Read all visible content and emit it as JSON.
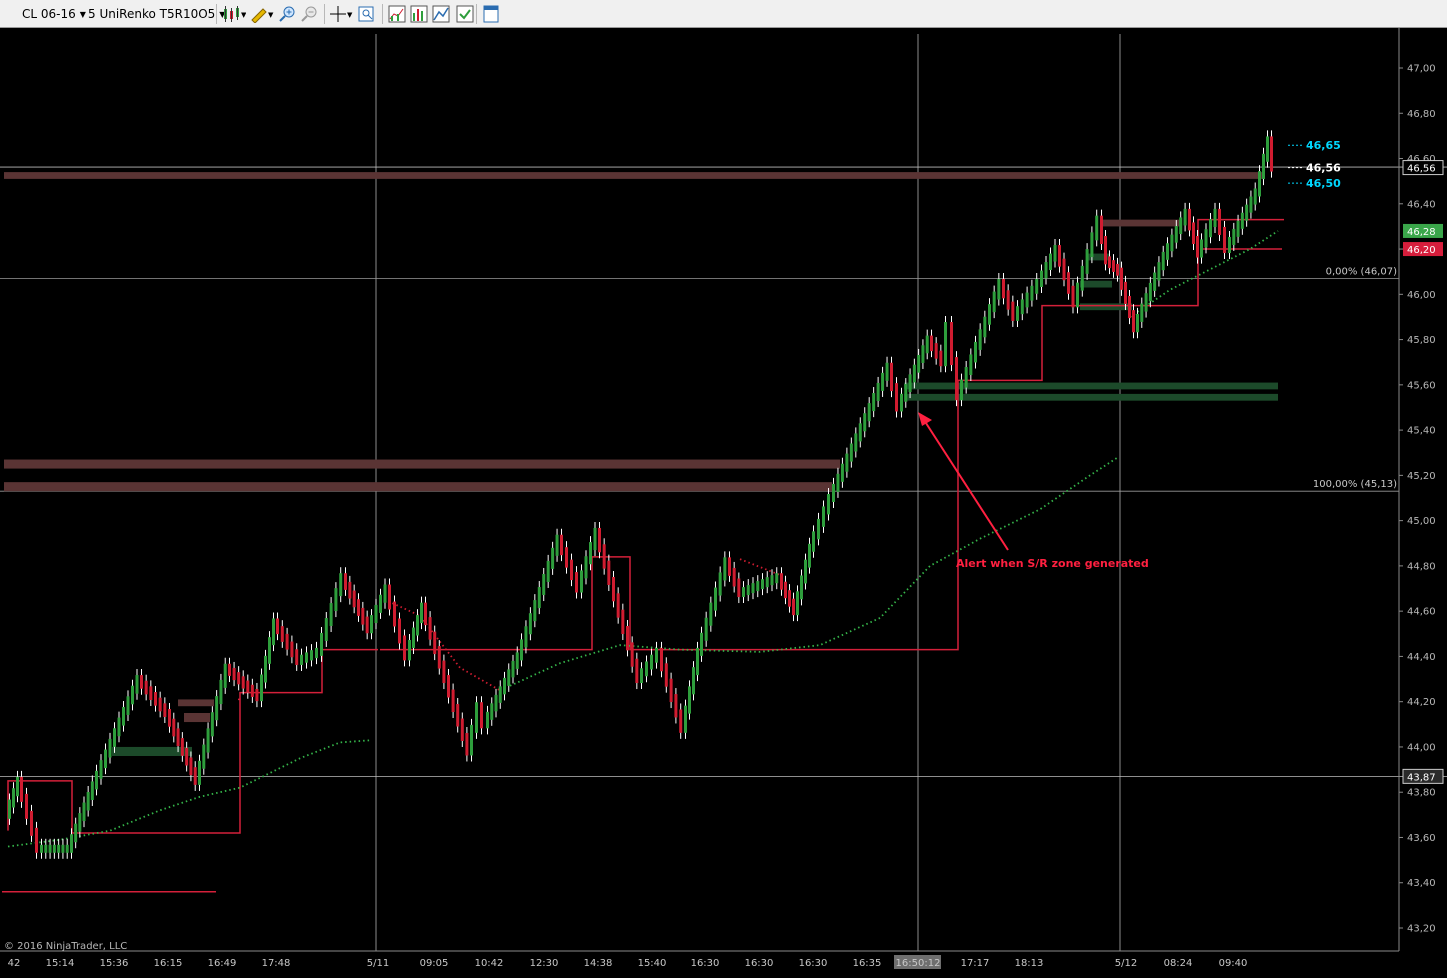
{
  "toolbar": {
    "instrument": "CL 06-16",
    "period": "5 UniRenko T5R10O5",
    "tools": [
      {
        "name": "bar-type-icon",
        "icon": "candlestick-bars"
      },
      {
        "name": "draw-tool-icon",
        "icon": "pencil"
      },
      {
        "name": "zoom-in-icon",
        "icon": "magnifier-plus"
      },
      {
        "name": "zoom-out-icon",
        "icon": "magnifier-minus"
      },
      {
        "name": "crosshair-icon",
        "icon": "crosshair"
      },
      {
        "name": "data-box-icon",
        "icon": "data-box"
      },
      {
        "name": "indicators-icon",
        "icon": "indicators"
      },
      {
        "name": "strategies-icon",
        "icon": "strategies"
      },
      {
        "name": "chart-properties-icon",
        "icon": "chart-properties"
      },
      {
        "name": "window-linking-icon",
        "icon": "window"
      }
    ]
  },
  "chart": {
    "copyright": "© 2016 NinjaTrader, LLC",
    "price_axis": {
      "min": 43.1,
      "max": 47.1,
      "ticks": [
        "47,00",
        "46,80",
        "46,60",
        "46,40",
        "46,20",
        "46,00",
        "45,80",
        "45,60",
        "45,40",
        "45,20",
        "45,00",
        "44,80",
        "44,60",
        "44,40",
        "44,20",
        "44,00",
        "43,80",
        "43,60",
        "43,40",
        "43,20"
      ]
    },
    "time_axis": {
      "labels": [
        "42",
        "15:14",
        "15:36",
        "16:15",
        "16:49",
        "17:48",
        "5/11",
        "09:05",
        "10:42",
        "12:30",
        "14:38",
        "15:40",
        "16:30",
        "16:30",
        "16:30",
        "16:35",
        "16:50:12",
        "17:17",
        "18:13",
        "5/12",
        "08:24",
        "09:40"
      ],
      "highlighted": "16:50:12"
    },
    "axis_badges": [
      {
        "text": "46,56",
        "value": 46.56,
        "bg": "#000000",
        "fg": "#ffffff",
        "border": "#cccccc"
      },
      {
        "text": "46,28",
        "value": 46.28,
        "bg": "#3aa64a",
        "fg": "#ffffff"
      },
      {
        "text": "46,20",
        "value": 46.2,
        "bg": "#d61e3c",
        "fg": "#ffffff"
      },
      {
        "text": "43,87",
        "value": 43.87,
        "bg": "#2a2a2a",
        "fg": "#ffffff",
        "border": "#cccccc"
      }
    ],
    "price_markers": [
      {
        "text": "46,65",
        "value": 46.65,
        "color": "#00d8ff"
      },
      {
        "text": "46,56",
        "value": 46.56,
        "color": "#ffffff"
      },
      {
        "text": "46,50",
        "value": 46.5,
        "color": "#00d8ff"
      }
    ],
    "fib_levels": [
      {
        "text": "0,00% (46,07)",
        "value": 46.07
      },
      {
        "text": "100,00% (45,13)",
        "value": 45.13
      }
    ],
    "crosshair_price": 43.87,
    "annotation": {
      "text": "Alert when S/R zone generated",
      "color": "#ff2040"
    },
    "colors": {
      "up": "#2e9e3c",
      "down": "#d01c30",
      "wick": "#ffffff",
      "resistance_zone": "#5a3434",
      "support_zone": "#1c4a2a",
      "sr_line": "#d4203a",
      "ma_green": "#35b54a",
      "ma_red": "#d01c30",
      "grid": "#b0b0b0"
    }
  }
}
